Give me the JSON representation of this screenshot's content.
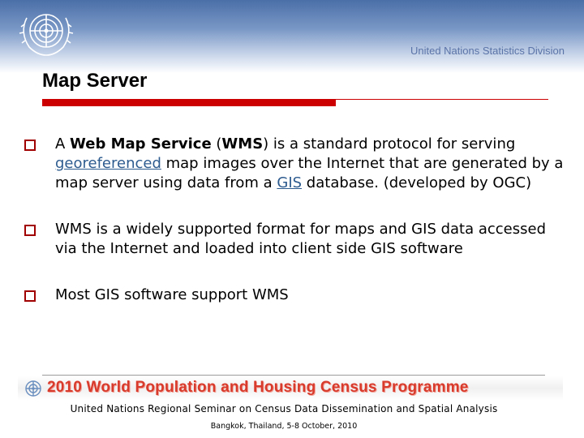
{
  "header": {
    "organization": "United Nations Statistics Division"
  },
  "slide": {
    "title": "Map Server",
    "bullets": [
      {
        "prefix": "A ",
        "bold_term": "Web Map Service",
        "mid1": " (",
        "bold_abbr": "WMS",
        "mid2": ") is a standard protocol for serving ",
        "link1": "georeferenced",
        "mid3": " map images over the Internet that are generated by a map server using data from a ",
        "link2": "GIS",
        "suffix": " database. (developed by OGC)"
      },
      {
        "text": "WMS is a widely supported format for maps and GIS data accessed via the Internet and loaded into client side GIS software"
      },
      {
        "text": "Most GIS software support WMS"
      }
    ]
  },
  "footer": {
    "banner": "2010 World Population and Housing Census Programme",
    "seminar": "United Nations Regional Seminar on Census Data Dissemination and Spatial Analysis",
    "location": "Bangkok, Thailand, 5-8 October, 2010"
  },
  "colors": {
    "accent_red": "#cc0000",
    "header_blue": "#4a6fa8",
    "link_blue": "#2d5b8f",
    "banner_red": "#d83a2b"
  },
  "icons": [
    "un-emblem-icon",
    "checkbox-bullet-icon",
    "census-logo-icon"
  ]
}
